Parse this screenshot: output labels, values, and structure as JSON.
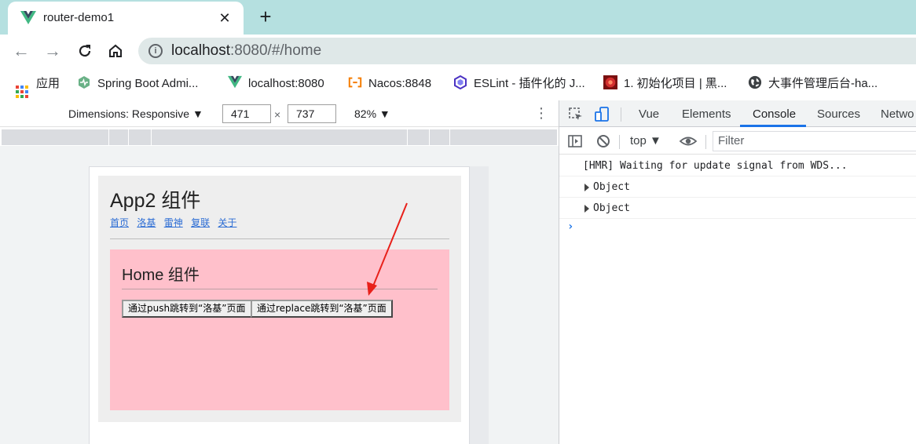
{
  "browser": {
    "tab_title": "router-demo1",
    "tab_close": "✕",
    "new_tab": "+",
    "url_host": "localhost",
    "url_rest": ":8080/#/home"
  },
  "bookmarks": [
    {
      "label": "应用",
      "icon": "apps-grid-icon"
    },
    {
      "label": "Spring Boot Admi...",
      "icon": "spring-boot-icon",
      "color": "#6ab187"
    },
    {
      "label": "localhost:8080",
      "icon": "vue-icon",
      "color": "#41b883"
    },
    {
      "label": "Nacos:8848",
      "icon": "nacos-icon",
      "color": "#f57c00"
    },
    {
      "label": "ESLint - 插件化的 J...",
      "icon": "eslint-icon",
      "color": "#4b32c3"
    },
    {
      "label": "1. 初始化项目 | 黑...",
      "icon": "heima-icon",
      "color": "#c62828"
    },
    {
      "label": "大事件管理后台-ha...",
      "icon": "globe-icon"
    }
  ],
  "device_toolbar": {
    "dimensions_label": "Dimensions: Responsive ▼",
    "width": "471",
    "height": "737",
    "times": "×",
    "zoom": "82% ▼"
  },
  "app": {
    "title": "App2 组件",
    "nav": [
      "首页",
      "洛基",
      "雷神",
      "复联",
      "关于"
    ],
    "home_title": "Home 组件",
    "push_button": "通过push跳转到“洛基”页面",
    "replace_button": "通过replace跳转到“洛基”页面"
  },
  "annotation_color": "#e8201a",
  "devtools": {
    "tabs": [
      "Vue",
      "Elements",
      "Console",
      "Sources",
      "Netwo"
    ],
    "active_tab": "Console",
    "context": "top ▼",
    "filter_placeholder": "Filter",
    "console_lines": [
      "[HMR] Waiting for update signal from WDS...",
      "Object",
      "Object"
    ],
    "prompt": "›"
  }
}
